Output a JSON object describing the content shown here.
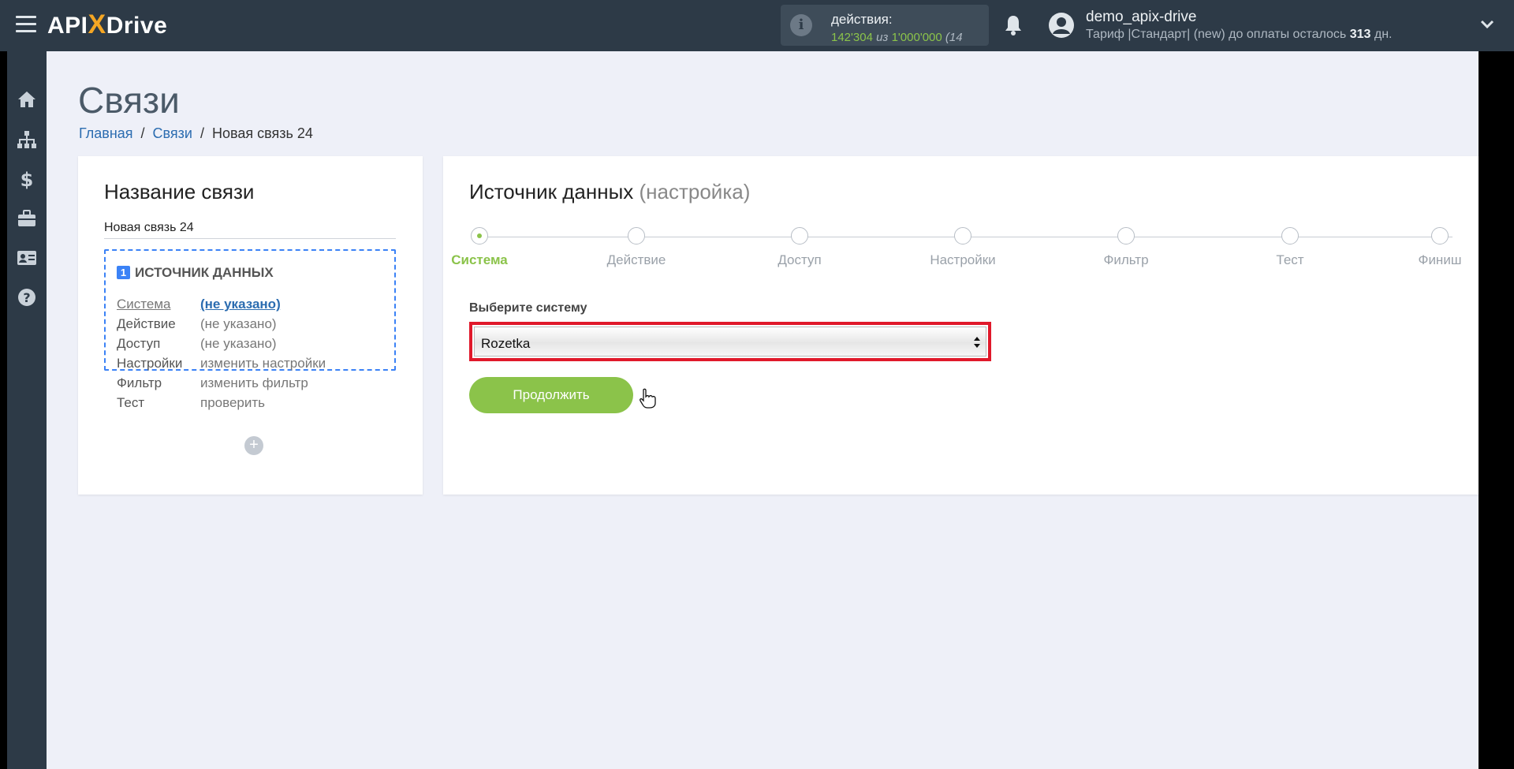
{
  "header": {
    "logo_text_a": "API",
    "logo_text_x": "X",
    "logo_text_b": "Drive",
    "actions_label": "действия:",
    "actions_used": "142'304",
    "actions_of": "из",
    "actions_total": "1'000'000",
    "actions_extra": "(14",
    "username": "demo_apix-drive",
    "tariff_prefix": "Тариф |Стандарт| (new) до оплаты осталось",
    "tariff_days": "313",
    "tariff_suffix": "дн."
  },
  "sidebar": {
    "items": [
      "home-icon",
      "sitemap-icon",
      "dollar-icon",
      "briefcase-icon",
      "id-card-icon",
      "help-icon"
    ]
  },
  "page": {
    "title": "Связи",
    "breadcrumb": [
      "Главная",
      "Связи",
      "Новая связь 24"
    ]
  },
  "left_card": {
    "title": "Название связи",
    "connection_name": "Новая связь 24",
    "source_number": "1",
    "source_heading": "ИСТОЧНИК ДАННЫХ",
    "rows": [
      {
        "key": "Система",
        "value": "(не указано)"
      },
      {
        "key": "Действие",
        "value": "(не указано)"
      },
      {
        "key": "Доступ",
        "value": "(не указано)"
      },
      {
        "key": "Настройки",
        "value": "изменить настройки"
      },
      {
        "key": "Фильтр",
        "value": "изменить фильтр"
      },
      {
        "key": "Тест",
        "value": "проверить"
      }
    ],
    "add_symbol": "+"
  },
  "right_card": {
    "title": "Источник данных",
    "subtitle": "(настройка)",
    "steps": [
      "Система",
      "Действие",
      "Доступ",
      "Настройки",
      "Фильтр",
      "Тест",
      "Финиш"
    ],
    "active_step": 0,
    "select_label": "Выберите систему",
    "selected_system": "Rozetka",
    "continue_label": "Продолжить"
  },
  "colors": {
    "accent_green": "#8bc34a",
    "header_bg": "#2d3a47",
    "highlight_red": "#e0192b",
    "link_blue": "#2b6cb0"
  }
}
